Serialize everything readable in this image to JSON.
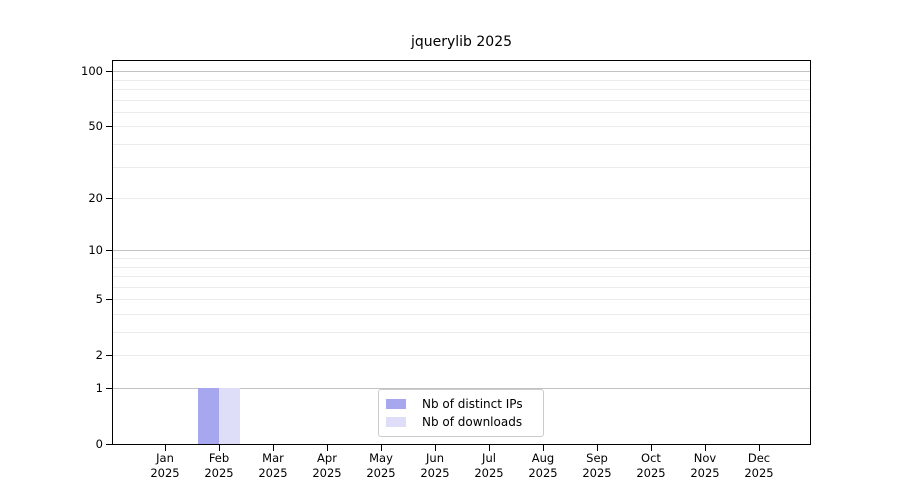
{
  "chart_data": {
    "type": "bar",
    "title": "jquerylib 2025",
    "categories": [
      "Jan 2025",
      "Feb 2025",
      "Mar 2025",
      "Apr 2025",
      "May 2025",
      "Jun 2025",
      "Jul 2025",
      "Aug 2025",
      "Sep 2025",
      "Oct 2025",
      "Nov 2025",
      "Dec 2025"
    ],
    "series": [
      {
        "name": "Nb of distinct IPs",
        "color": "#a7a7f0",
        "values": [
          0,
          1,
          0,
          0,
          0,
          0,
          0,
          0,
          0,
          0,
          0,
          0
        ]
      },
      {
        "name": "Nb of downloads",
        "color": "#dedef9",
        "values": [
          0,
          1,
          0,
          0,
          0,
          0,
          0,
          0,
          0,
          0,
          0,
          0
        ]
      }
    ],
    "xlabel": "",
    "ylabel": "",
    "yscale": "log1p",
    "ylim": [
      0,
      112
    ],
    "y_tick_values": [
      0,
      1,
      2,
      5,
      10,
      20,
      50,
      100
    ],
    "y_gridlines": {
      "major": [
        1,
        10,
        100
      ],
      "minor": [
        2,
        3,
        4,
        5,
        6,
        7,
        8,
        9,
        20,
        30,
        40,
        50,
        60,
        70,
        80,
        90
      ]
    },
    "grid": "horizontal",
    "legend_position": "lower-center",
    "colors": {
      "major_grid": "#c2c2c2",
      "minor_grid": "#ebebeb",
      "axis": "#000000",
      "legend_border": "#cccccc"
    }
  }
}
